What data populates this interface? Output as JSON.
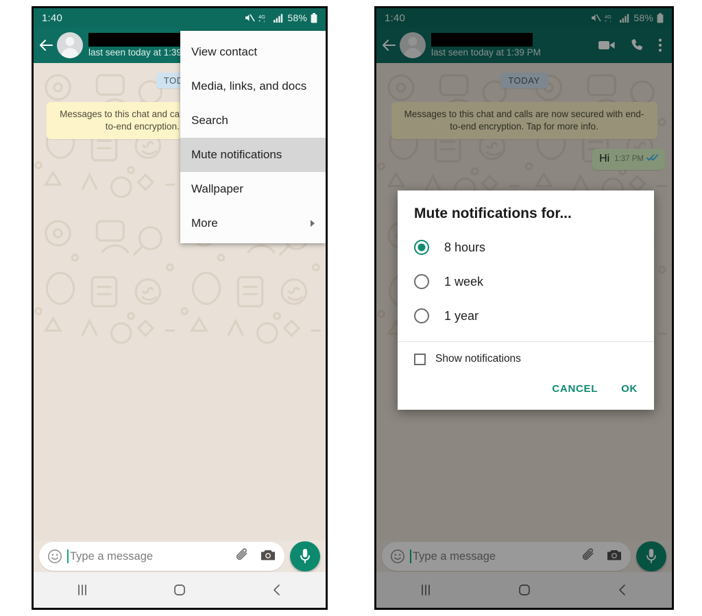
{
  "status_bar": {
    "clock": "1:40",
    "battery_percent": "58%",
    "network_label": "4G+",
    "icons": [
      "mute-icon",
      "network-4g-plus-icon",
      "signal-bars-icon",
      "battery-icon"
    ]
  },
  "app_bar": {
    "contact_name_redacted": "",
    "last_seen_left": "last seen today at 1:39",
    "last_seen_right": "last seen today at 1:39 PM",
    "actions": [
      "video-call-icon",
      "voice-call-icon",
      "overflow-menu-icon"
    ]
  },
  "chat": {
    "day_chip": "TODAY",
    "encryption_notice_left": "Messages to this chat and calls are now secured with end-to-end encryption. Tap for more info.",
    "encryption_notice_right": "Messages to this chat and calls are now secured with end-to-end encryption. Tap for more info.",
    "messages": [
      {
        "text": "Hi",
        "time": "1:37 PM",
        "status": "read",
        "direction": "outgoing"
      }
    ]
  },
  "composer": {
    "placeholder": "Type a message",
    "attach_icon": "paperclip-icon",
    "camera_icon": "camera-icon",
    "emoji_icon": "emoji-icon",
    "mic_icon": "microphone-icon"
  },
  "nav_bar": {
    "recents_label": "|||",
    "home_label": "home",
    "back_label": "back"
  },
  "overflow_menu": {
    "items": [
      {
        "label": "View contact",
        "selected": false,
        "submenu": false
      },
      {
        "label": "Media, links, and docs",
        "selected": false,
        "submenu": false
      },
      {
        "label": "Search",
        "selected": false,
        "submenu": false
      },
      {
        "label": "Mute notifications",
        "selected": true,
        "submenu": false
      },
      {
        "label": "Wallpaper",
        "selected": false,
        "submenu": false
      },
      {
        "label": "More",
        "selected": false,
        "submenu": true
      }
    ]
  },
  "mute_dialog": {
    "title": "Mute notifications for...",
    "options": [
      {
        "label": "8 hours",
        "selected": true
      },
      {
        "label": "1 week",
        "selected": false
      },
      {
        "label": "1 year",
        "selected": false
      }
    ],
    "checkbox": {
      "label": "Show notifications",
      "checked": false
    },
    "cancel_label": "CANCEL",
    "ok_label": "OK"
  },
  "colors": {
    "status_bar": "#0d6b5e",
    "app_bar": "#0e6e61",
    "accent_green": "#0c8a6e",
    "bubble_out": "#dcf8c6",
    "encryption_notice": "#fdf5c9",
    "day_chip": "#cfe2ef",
    "menu_selected": "#d6d6d6",
    "chat_background": "#e9e1d7"
  }
}
